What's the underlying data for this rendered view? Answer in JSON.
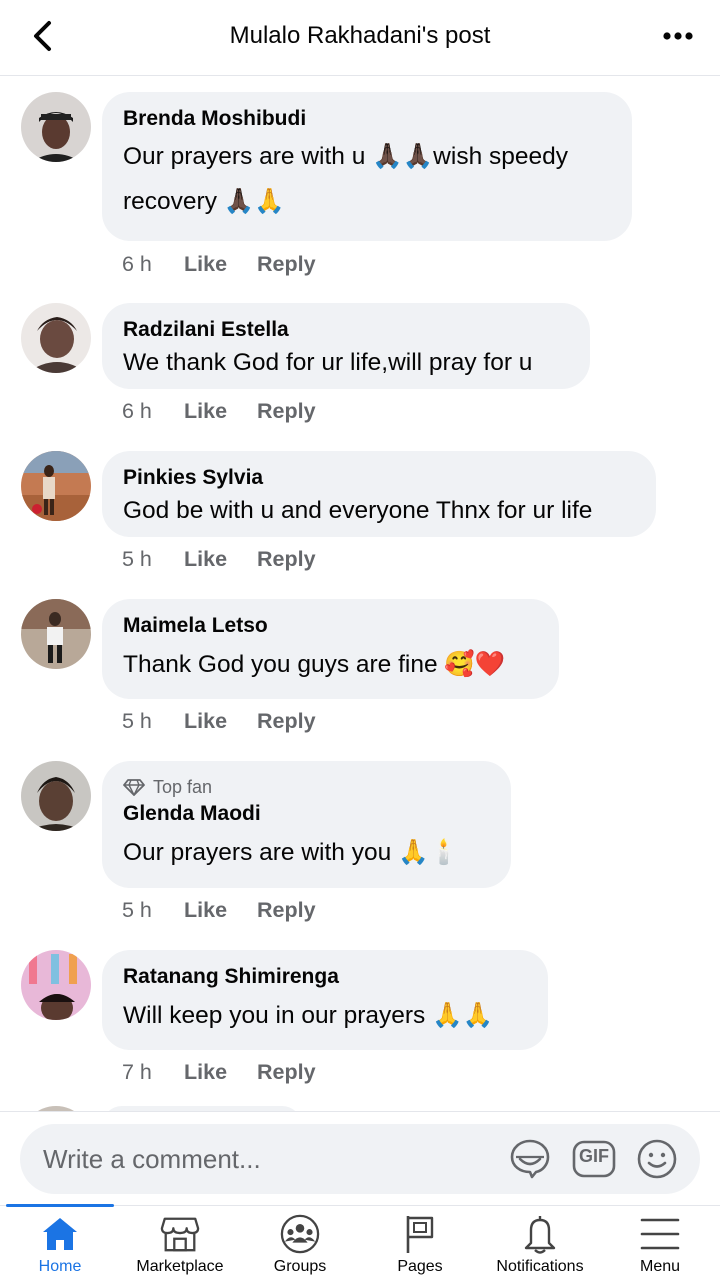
{
  "header": {
    "title": "Mulalo Rakhadani's post",
    "back_icon": "chevron-left-icon",
    "more_icon": "more-horizontal-icon"
  },
  "comments": [
    {
      "author": "Brenda Moshibudi",
      "text_line1": "Our prayers are with u 🙏🏿🙏🏿wish speedy",
      "text_line2": "recovery 🙏🏿🙏",
      "time": "6 h",
      "like": "Like",
      "reply": "Reply",
      "avatar_color": "#3a3030"
    },
    {
      "author": "Radzilani Estella",
      "text": "We thank God for ur life,will pray for u",
      "time": "6 h",
      "like": "Like",
      "reply": "Reply",
      "avatar_color": "#8a7a76"
    },
    {
      "author": "Pinkies Sylvia",
      "text": "God be with u and everyone Thnx for ur life",
      "time": "5 h",
      "like": "Like",
      "reply": "Reply",
      "avatar_color": "#b86a45"
    },
    {
      "author": "Maimela Letso",
      "text": "Thank God you guys are fine 🥰❤️",
      "time": "5 h",
      "like": "Like",
      "reply": "Reply",
      "avatar_color": "#a08a78"
    },
    {
      "badge": "Top fan",
      "badge_icon": "diamond-icon",
      "author": "Glenda Maodi",
      "text": "Our prayers are with you 🙏🕯️",
      "time": "5 h",
      "like": "Like",
      "reply": "Reply",
      "avatar_color": "#5a5048"
    },
    {
      "author": "Ratanang Shimirenga",
      "text": "Will keep you in our prayers 🙏🙏",
      "time": "7 h",
      "like": "Like",
      "reply": "Reply",
      "avatar_color": "#d8a0c8"
    }
  ],
  "composer": {
    "placeholder": "Write a comment...",
    "sticker_icon": "sticker-icon",
    "gif_label": "GIF",
    "emoji_icon": "smiley-icon"
  },
  "nav": {
    "items": [
      {
        "label": "Home",
        "icon": "home-icon",
        "active": true
      },
      {
        "label": "Marketplace",
        "icon": "marketplace-icon"
      },
      {
        "label": "Groups",
        "icon": "groups-icon"
      },
      {
        "label": "Pages",
        "icon": "flag-icon"
      },
      {
        "label": "Notifications",
        "icon": "bell-icon"
      },
      {
        "label": "Menu",
        "icon": "hamburger-icon"
      }
    ],
    "accent_color": "#1b74e4"
  }
}
